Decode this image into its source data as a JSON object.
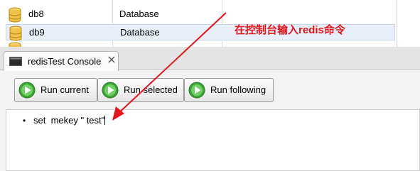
{
  "db_list": {
    "rows": [
      {
        "name": "db8",
        "type": "Database",
        "selected": false
      },
      {
        "name": "db9",
        "type": "Database",
        "selected": true
      },
      {
        "name": "",
        "type": "",
        "selected": false
      }
    ]
  },
  "console": {
    "tab_title": "redisTest Console",
    "buttons": {
      "run_current": "Run current",
      "run_selected": "Run selected",
      "run_following": "Run following"
    },
    "editor": {
      "bullet": "•",
      "command": "set  mekey \" test\""
    }
  },
  "annotation": {
    "text": "在控制台输入redis命令",
    "color": "#e8141c"
  },
  "icons": {
    "db": "database-cylinder-icon",
    "console": "console-window-icon",
    "close": "close-icon",
    "run": "green-play-icon"
  }
}
